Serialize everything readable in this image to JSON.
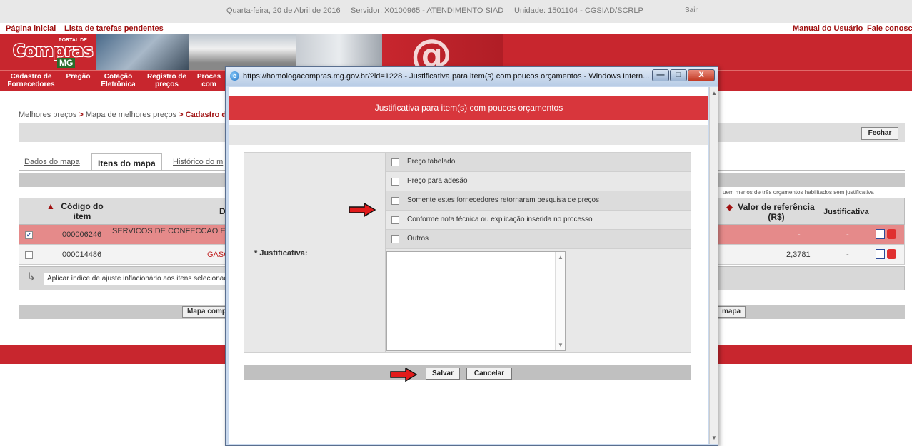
{
  "topbar": {
    "date": "Quarta-feira, 20 de Abril de 2016",
    "server": "Servidor: X0100965 - ATENDIMENTO SIAD",
    "unit": "Unidade: 1501104 - CGSIAD/SCRLP",
    "logout": "Sair"
  },
  "links": {
    "home": "Página inicial",
    "tasks": "Lista de tarefas pendentes",
    "manual": "Manual do Usuário",
    "contact": "Fale conosco"
  },
  "logo": {
    "main": "Compras",
    "sub": "MG",
    "portal": "PORTAL DE"
  },
  "menu": [
    "Cadastro de Fornecedores",
    "Pregão",
    "Cotação Eletrônica",
    "Registro de preços",
    "Proces com"
  ],
  "breadcrumb": {
    "part1": "Melhores preços",
    "sep": ">",
    "part2": "Mapa de melhores preços",
    "part3": "Cadastro d"
  },
  "close_button": "Fechar",
  "tabs": [
    "Dados do mapa",
    "Itens do mapa",
    "Histórico do m"
  ],
  "table_note": "uem menos de três orçamentos habilitados sem justificativa",
  "table": {
    "sort_arrow": "▲",
    "col_code": "Código do item",
    "col_desc": "D",
    "col_ref": "Valor de referência (R$)",
    "col_ref_arrow": "◆",
    "col_just": "Justificativa",
    "rows": [
      {
        "checked": "✔",
        "code": "000006246",
        "desc": "SERVICOS DE CONFECCAO E",
        "ref": "-",
        "just": "-"
      },
      {
        "checked": "",
        "code": "000014486",
        "desc": "GASC",
        "ref": "2,3781",
        "just": "-"
      }
    ]
  },
  "apply_button": "Aplicar índice de ajuste inflacionário aos itens selecionados",
  "bottom_buttons": {
    "left": "Mapa comp",
    "right": "mapa"
  },
  "modal": {
    "window_title": "https://homologacompras.mg.gov.br/?id=1228 - Justificativa para item(s) com poucos orçamentos - Windows Intern...",
    "heading": "Justificativa para item(s) com poucos orçamentos",
    "field_label": "* Justificativa:",
    "options": [
      "Preço tabelado",
      "Preço para adesão",
      "Somente estes fornecedores retornaram pesquisa de preços",
      "Conforme nota técnica ou explicação inserida no processo",
      "Outros"
    ],
    "save": "Salvar",
    "cancel": "Cancelar",
    "min": "—",
    "max": "□",
    "close": "X"
  },
  "colors": {
    "brand_red": "#c8262e",
    "modal_red": "#d8363c",
    "selected_row": "#e58a8a",
    "annotation_arrow": "#e21b1b"
  }
}
